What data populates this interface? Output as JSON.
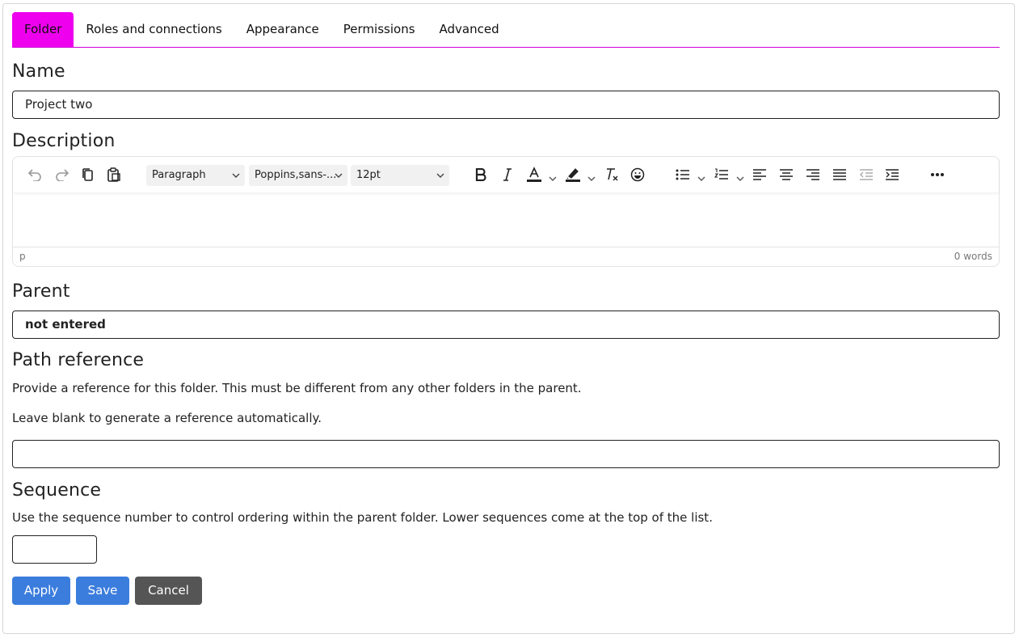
{
  "tabs": [
    {
      "label": "Folder",
      "active": true
    },
    {
      "label": "Roles and connections",
      "active": false
    },
    {
      "label": "Appearance",
      "active": false
    },
    {
      "label": "Permissions",
      "active": false
    },
    {
      "label": "Advanced",
      "active": false
    }
  ],
  "accent_color": "#ee00ee",
  "name": {
    "label": "Name",
    "value": "Project two"
  },
  "description": {
    "label": "Description",
    "toolbar": {
      "block_format": "Paragraph",
      "font_family": "Poppins,sans-...",
      "font_size": "12pt",
      "icons": [
        "undo-icon",
        "redo-icon",
        "copy-icon",
        "paste-icon",
        "bold-icon",
        "italic-icon",
        "text-color-icon",
        "highlight-icon",
        "clear-format-icon",
        "emoji-icon",
        "bullet-list-icon",
        "numbered-list-icon",
        "align-left-icon",
        "align-center-icon",
        "align-right-icon",
        "justify-icon",
        "outdent-icon",
        "indent-icon",
        "more-icon"
      ]
    },
    "status_path": "p",
    "word_count": "0 words"
  },
  "parent": {
    "label": "Parent",
    "value": "not entered"
  },
  "path_reference": {
    "label": "Path reference",
    "help1": "Provide a reference for this folder. This must be different from any other folders in the parent.",
    "help2": "Leave blank to generate a reference automatically.",
    "value": ""
  },
  "sequence": {
    "label": "Sequence",
    "help": "Use the sequence number to control ordering within the parent folder. Lower sequences come at the top of the list.",
    "value": ""
  },
  "buttons": {
    "apply": "Apply",
    "save": "Save",
    "cancel": "Cancel"
  },
  "colors": {
    "primary_button": "#3b7ddd",
    "cancel_button": "#555555"
  }
}
